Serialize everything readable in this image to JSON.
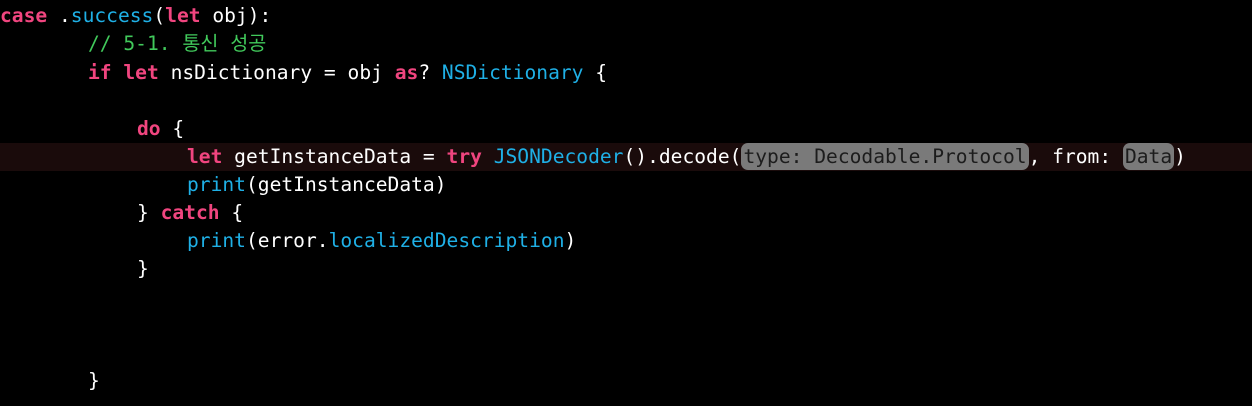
{
  "colors": {
    "background": "#000000",
    "keyword": "#f0457f",
    "type": "#1fb0e6",
    "comment": "#41c95b",
    "placeholder_bg": "#7a7a7a",
    "current_line": "#1a0b0b"
  },
  "code": {
    "l1": {
      "kw_case": "case",
      "t1": " .",
      "member": "success",
      "t2": "(",
      "kw_let": "let",
      "t3": " obj):"
    },
    "l2": {
      "comment": "// 5-1. 통신 성공"
    },
    "l3": {
      "kw_if": "if",
      "sp1": " ",
      "kw_let": "let",
      "t1": " nsDictionary = obj ",
      "kw_as": "as",
      "t2": "? ",
      "type": "NSDictionary",
      "t3": " {"
    },
    "l5": {
      "kw_do": "do",
      "t1": " {"
    },
    "l6": {
      "kw_let": "let",
      "t1": " getInstanceData = ",
      "kw_try": "try",
      "sp1": " ",
      "type": "JSONDecoder",
      "t2": "().decode(",
      "ph1": "type: Decodable.Protocol",
      "t3": ", from: ",
      "ph2": "Data",
      "t4": ")"
    },
    "l7": {
      "fn": "print",
      "t1": "(getInstanceData)"
    },
    "l8": {
      "t1": "} ",
      "kw_catch": "catch",
      "t2": " {"
    },
    "l9": {
      "fn": "print",
      "t1": "(error.",
      "member": "localizedDescription",
      "t2": ")"
    },
    "l10": {
      "t1": "}"
    },
    "l14": {
      "t1": "}"
    }
  }
}
